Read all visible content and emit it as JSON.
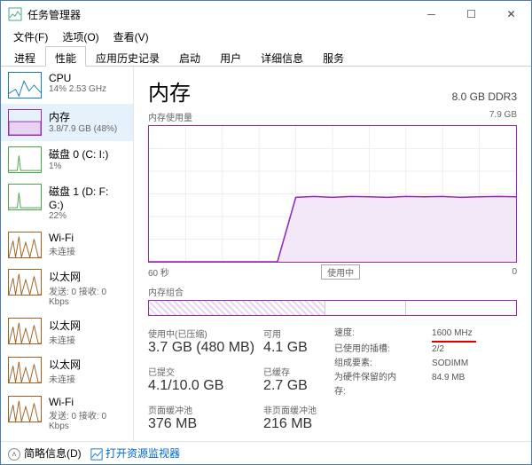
{
  "window": {
    "title": "任务管理器"
  },
  "menu": {
    "file": "文件(F)",
    "options": "选项(O)",
    "view": "查看(V)"
  },
  "tabs": [
    "进程",
    "性能",
    "应用历史记录",
    "启动",
    "用户",
    "详细信息",
    "服务"
  ],
  "active_tab": 1,
  "sidebar": [
    {
      "name": "CPU",
      "sub": "14% 2.53 GHz",
      "type": "cpu"
    },
    {
      "name": "内存",
      "sub": "3.8/7.9 GB (48%)",
      "type": "mem",
      "selected": true
    },
    {
      "name": "磁盘 0 (C: I:)",
      "sub": "1%",
      "type": "disk"
    },
    {
      "name": "磁盘 1 (D: F: G:)",
      "sub": "22%",
      "type": "disk"
    },
    {
      "name": "Wi-Fi",
      "sub": "未连接",
      "type": "net"
    },
    {
      "name": "以太网",
      "sub": "发送: 0 接收: 0 Kbps",
      "type": "net"
    },
    {
      "name": "以太网",
      "sub": "未连接",
      "type": "net"
    },
    {
      "name": "以太网",
      "sub": "未连接",
      "type": "net"
    },
    {
      "name": "Wi-Fi",
      "sub": "发送: 0 接收: 0 Kbps",
      "type": "net"
    }
  ],
  "main": {
    "title": "内存",
    "right": "8.0 GB DDR3",
    "chart_title": "内存使用量",
    "chart_max": "7.9 GB",
    "x_left": "60 秒",
    "x_mid": "使用中",
    "x_right": "0",
    "composition_title": "内存组合",
    "stats": {
      "used_label": "使用中(已压缩)",
      "used_val": "3.7 GB (480 MB)",
      "avail_label": "可用",
      "avail_val": "4.1 GB",
      "committed_label": "已提交",
      "committed_val": "4.1/10.0 GB",
      "cached_label": "已缓存",
      "cached_val": "2.7 GB",
      "paged_label": "页面缓冲池",
      "paged_val": "376 MB",
      "nonpaged_label": "非页面缓冲池",
      "nonpaged_val": "216 MB"
    },
    "kv": {
      "speed_k": "速度:",
      "speed_v": "1600 MHz",
      "slots_k": "已使用的插槽:",
      "slots_v": "2/2",
      "form_k": "组成要素:",
      "form_v": "SODIMM",
      "reserved_k": "为硬件保留的内存:",
      "reserved_v": "84.9 MB"
    }
  },
  "footer": {
    "brief": "简略信息(D)",
    "monitor": "打开资源监视器"
  },
  "chart_data": {
    "type": "area",
    "title": "内存使用量",
    "ylabel": "GB",
    "ylim": [
      0,
      7.9
    ],
    "xlabel": "秒",
    "xlim": [
      60,
      0
    ],
    "x": [
      60,
      57,
      54,
      51,
      48,
      45,
      42,
      39,
      36,
      33,
      30,
      27,
      24,
      21,
      18,
      15,
      12,
      9,
      6,
      3,
      0
    ],
    "values": [
      0,
      0,
      0,
      0,
      0,
      0,
      0,
      0,
      3.75,
      3.8,
      3.75,
      3.8,
      3.78,
      3.75,
      3.8,
      3.78,
      3.8,
      3.75,
      3.78,
      3.8,
      3.78
    ]
  }
}
